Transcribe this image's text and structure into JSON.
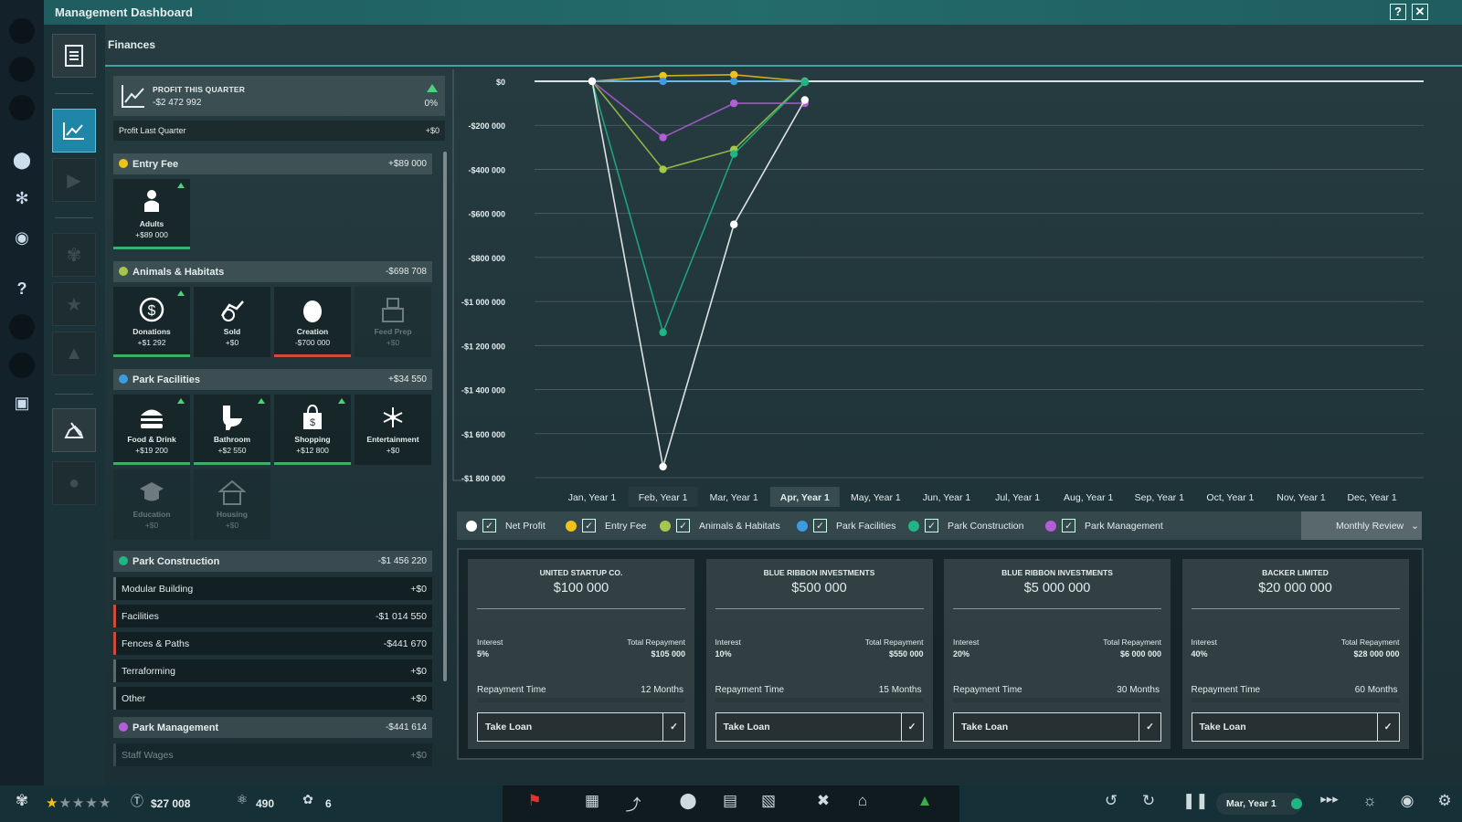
{
  "window": {
    "title": "Management Dashboard",
    "help_label": "?",
    "close_label": "✕"
  },
  "section_title": "Finances",
  "profit": {
    "title": "PROFIT THIS QUARTER",
    "value": "-$2 472 992",
    "change": "0%",
    "last_label": "Profit Last Quarter",
    "last_value": "+$0"
  },
  "entry_fee": {
    "label": "Entry Fee",
    "value": "+$89 000",
    "tiles": [
      {
        "label": "Adults",
        "value": "+$89 000"
      }
    ]
  },
  "animals": {
    "label": "Animals & Habitats",
    "value": "-$698 708",
    "tiles": [
      {
        "label": "Donations",
        "value": "+$1 292"
      },
      {
        "label": "Sold",
        "value": "+$0"
      },
      {
        "label": "Creation",
        "value": "-$700 000"
      },
      {
        "label": "Feed Prep",
        "value": "+$0"
      }
    ]
  },
  "facilities": {
    "label": "Park Facilities",
    "value": "+$34 550",
    "tiles": [
      {
        "label": "Food & Drink",
        "value": "+$19 200"
      },
      {
        "label": "Bathroom",
        "value": "+$2 550"
      },
      {
        "label": "Shopping",
        "value": "+$12 800"
      },
      {
        "label": "Entertainment",
        "value": "+$0"
      },
      {
        "label": "Education",
        "value": "+$0"
      },
      {
        "label": "Housing",
        "value": "+$0"
      }
    ]
  },
  "construction": {
    "label": "Park Construction",
    "value": "-$1 456 220",
    "rows": [
      {
        "label": "Modular Building",
        "value": "+$0"
      },
      {
        "label": "Facilities",
        "value": "-$1 014 550"
      },
      {
        "label": "Fences & Paths",
        "value": "-$441 670"
      },
      {
        "label": "Terraforming",
        "value": "+$0"
      },
      {
        "label": "Other",
        "value": "+$0"
      }
    ]
  },
  "management": {
    "label": "Park Management",
    "value": "-$441 614",
    "rows": [
      {
        "label": "Staff Wages",
        "value": "+$0"
      }
    ]
  },
  "colors": {
    "net_profit": "#ffffff",
    "entry_fee": "#f2c21b",
    "animals": "#a5c74a",
    "facilities": "#3d9be0",
    "construction": "#1fb585",
    "management": "#b35ed8",
    "accent": "#1f86a8"
  },
  "chart_data": {
    "type": "line",
    "categories": [
      "Jan, Year 1",
      "Feb, Year 1",
      "Mar, Year 1",
      "Apr, Year 1",
      "May, Year 1",
      "Jun, Year 1",
      "Jul, Year 1",
      "Aug, Year 1",
      "Sep, Year 1",
      "Oct, Year 1",
      "Nov, Year 1",
      "Dec, Year 1"
    ],
    "y_ticks": [
      "$0",
      "-$200 000",
      "-$400 000",
      "-$600 000",
      "-$800 000",
      "-$1 000 000",
      "-$1 200 000",
      "-$1 400 000",
      "-$1 600 000",
      "-$1 800 000"
    ],
    "ylim": [
      -1800000,
      0
    ],
    "selected_month": "Apr, Year 1",
    "series": [
      {
        "name": "Entry Fee",
        "values": [
          0,
          25000,
          30000,
          0
        ]
      },
      {
        "name": "Park Facilities",
        "values": [
          0,
          0,
          0,
          0
        ]
      },
      {
        "name": "Animals & Habitats",
        "values": [
          0,
          -400000,
          -310000,
          -3000
        ]
      },
      {
        "name": "Park Construction",
        "values": [
          0,
          -1140000,
          -330000,
          -5000
        ]
      },
      {
        "name": "Park Management",
        "values": [
          0,
          -255000,
          -100000,
          -100000
        ]
      },
      {
        "name": "Net Profit",
        "values": [
          0,
          -1750000,
          -650000,
          -85000
        ]
      }
    ],
    "grid": true
  },
  "legend": {
    "items": [
      "Net Profit",
      "Entry Fee",
      "Animals & Habitats",
      "Park Facilities",
      "Park Construction",
      "Park Management"
    ],
    "review_label": "Monthly Review"
  },
  "loans": [
    {
      "lender": "UNITED STARTUP CO.",
      "amount": "$100 000",
      "interest_label": "Interest",
      "interest": "5%",
      "total_label": "Total Repayment",
      "total": "$105 000",
      "time_label": "Repayment Time",
      "time": "12 Months",
      "button": "Take Loan"
    },
    {
      "lender": "BLUE RIBBON INVESTMENTS",
      "amount": "$500 000",
      "interest_label": "Interest",
      "interest": "10%",
      "total_label": "Total Repayment",
      "total": "$550 000",
      "time_label": "Repayment Time",
      "time": "15 Months",
      "button": "Take Loan"
    },
    {
      "lender": "BLUE RIBBON INVESTMENTS",
      "amount": "$5 000 000",
      "interest_label": "Interest",
      "interest": "20%",
      "total_label": "Total Repayment",
      "total": "$6 000 000",
      "time_label": "Repayment Time",
      "time": "30 Months",
      "button": "Take Loan"
    },
    {
      "lender": "BACKER LIMITED",
      "amount": "$20 000 000",
      "interest_label": "Interest",
      "interest": "40%",
      "total_label": "Total Repayment",
      "total": "$28 000 000",
      "time_label": "Repayment Time",
      "time": "60 Months",
      "button": "Take Loan"
    }
  ],
  "status": {
    "rating_stars": 1,
    "rating_max": 5,
    "money": "$27 008",
    "research": "490",
    "dinos": "6",
    "date": "Mar, Year 1"
  }
}
